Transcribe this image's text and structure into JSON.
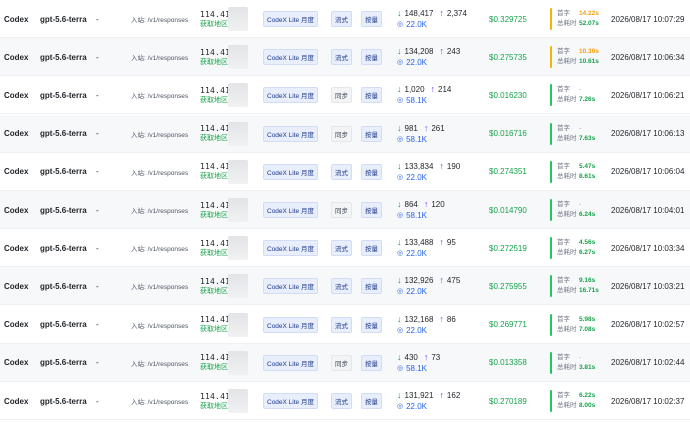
{
  "labels": {
    "first_token": "首字",
    "total_time": "总耗时",
    "endpoint_prefix": "入站: ",
    "cache_icon": "database-icon",
    "down_icon": "arrow-down-icon",
    "up_icon": "arrow-up-icon"
  },
  "colors": {
    "accent_green": "#16a34a",
    "accent_blue": "#2563eb",
    "accent_purple": "#7c3aed",
    "accent_orange": "#f59e0b",
    "plan_badge_bg": "#e8eefc"
  },
  "rows": [
    {
      "provider": "Codex",
      "model": "gpt-5.6-terra",
      "dash": "-",
      "endpoint": "入站: /v1/responses",
      "ip": "114.41",
      "geo": "获取地区",
      "plan": "CodeX Lite 月度",
      "mode": "流式",
      "mode_type": "stream",
      "billing": "按量",
      "input": "148,417",
      "output": "2,374",
      "cache": "22.0K",
      "cost": "$0.329725",
      "first_token": "14.22s",
      "first_token_color": "orange",
      "total": "52.07s",
      "total_color": "green",
      "bar": "yellow",
      "time": "2026/08/17 10:07:29"
    },
    {
      "provider": "Codex",
      "model": "gpt-5.6-terra",
      "dash": "-",
      "endpoint": "入站: /v1/responses",
      "ip": "114.41",
      "geo": "获取地区",
      "plan": "CodeX Lite 月度",
      "mode": "流式",
      "mode_type": "stream",
      "billing": "按量",
      "input": "134,208",
      "output": "243",
      "cache": "22.0K",
      "cost": "$0.275735",
      "first_token": "10.30s",
      "first_token_color": "orange",
      "total": "10.61s",
      "total_color": "green",
      "bar": "yellow",
      "time": "2026/08/17 10:06:34"
    },
    {
      "provider": "Codex",
      "model": "gpt-5.6-terra",
      "dash": "-",
      "endpoint": "入站: /v1/responses",
      "ip": "114.41",
      "geo": "获取地区",
      "plan": "CodeX Lite 月度",
      "mode": "同步",
      "mode_type": "sync",
      "billing": "按量",
      "input": "1,020",
      "output": "214",
      "cache": "58.1K",
      "cost": "$0.016230",
      "first_token": "-",
      "first_token_color": "gray",
      "total": "7.26s",
      "total_color": "green",
      "bar": "green",
      "time": "2026/08/17 10:06:21"
    },
    {
      "provider": "Codex",
      "model": "gpt-5.6-terra",
      "dash": "-",
      "endpoint": "入站: /v1/responses",
      "ip": "114.41",
      "geo": "获取地区",
      "plan": "CodeX Lite 月度",
      "mode": "同步",
      "mode_type": "sync",
      "billing": "按量",
      "input": "981",
      "output": "261",
      "cache": "58.1K",
      "cost": "$0.016716",
      "first_token": "-",
      "first_token_color": "gray",
      "total": "7.63s",
      "total_color": "green",
      "bar": "green",
      "time": "2026/08/17 10:06:13"
    },
    {
      "provider": "Codex",
      "model": "gpt-5.6-terra",
      "dash": "-",
      "endpoint": "入站: /v1/responses",
      "ip": "114.41",
      "geo": "获取地区",
      "plan": "CodeX Lite 月度",
      "mode": "流式",
      "mode_type": "stream",
      "billing": "按量",
      "input": "133,834",
      "output": "190",
      "cache": "22.0K",
      "cost": "$0.274351",
      "first_token": "5.47s",
      "first_token_color": "green",
      "total": "8.61s",
      "total_color": "green",
      "bar": "green",
      "time": "2026/08/17 10:06:04"
    },
    {
      "provider": "Codex",
      "model": "gpt-5.6-terra",
      "dash": "-",
      "endpoint": "入站: /v1/responses",
      "ip": "114.41",
      "geo": "获取地区",
      "plan": "CodeX Lite 月度",
      "mode": "同步",
      "mode_type": "sync",
      "billing": "按量",
      "input": "864",
      "output": "120",
      "cache": "58.1K",
      "cost": "$0.014790",
      "first_token": "-",
      "first_token_color": "gray",
      "total": "6.24s",
      "total_color": "green",
      "bar": "green",
      "time": "2026/08/17 10:04:01"
    },
    {
      "provider": "Codex",
      "model": "gpt-5.6-terra",
      "dash": "-",
      "endpoint": "入站: /v1/responses",
      "ip": "114.41",
      "geo": "获取地区",
      "plan": "CodeX Lite 月度",
      "mode": "流式",
      "mode_type": "stream",
      "billing": "按量",
      "input": "133,488",
      "output": "95",
      "cache": "22.0K",
      "cost": "$0.272519",
      "first_token": "4.56s",
      "first_token_color": "green",
      "total": "6.27s",
      "total_color": "green",
      "bar": "green",
      "time": "2026/08/17 10:03:34"
    },
    {
      "provider": "Codex",
      "model": "gpt-5.6-terra",
      "dash": "-",
      "endpoint": "入站: /v1/responses",
      "ip": "114.41",
      "geo": "获取地区",
      "plan": "CodeX Lite 月度",
      "mode": "流式",
      "mode_type": "stream",
      "billing": "按量",
      "input": "132,926",
      "output": "475",
      "cache": "22.0K",
      "cost": "$0.275955",
      "first_token": "9.16s",
      "first_token_color": "green",
      "total": "16.71s",
      "total_color": "green",
      "bar": "green",
      "time": "2026/08/17 10:03:21"
    },
    {
      "provider": "Codex",
      "model": "gpt-5.6-terra",
      "dash": "-",
      "endpoint": "入站: /v1/responses",
      "ip": "114.41",
      "geo": "获取地区",
      "plan": "CodeX Lite 月度",
      "mode": "流式",
      "mode_type": "stream",
      "billing": "按量",
      "input": "132,168",
      "output": "86",
      "cache": "22.0K",
      "cost": "$0.269771",
      "first_token": "5.98s",
      "first_token_color": "green",
      "total": "7.08s",
      "total_color": "green",
      "bar": "green",
      "time": "2026/08/17 10:02:57"
    },
    {
      "provider": "Codex",
      "model": "gpt-5.6-terra",
      "dash": "-",
      "endpoint": "入站: /v1/responses",
      "ip": "114.41",
      "geo": "获取地区",
      "plan": "CodeX Lite 月度",
      "mode": "同步",
      "mode_type": "sync",
      "billing": "按量",
      "input": "430",
      "output": "73",
      "cache": "58.1K",
      "cost": "$0.013358",
      "first_token": "-",
      "first_token_color": "gray",
      "total": "3.81s",
      "total_color": "green",
      "bar": "green",
      "time": "2026/08/17 10:02:44"
    },
    {
      "provider": "Codex",
      "model": "gpt-5.6-terra",
      "dash": "-",
      "endpoint": "入站: /v1/responses",
      "ip": "114.41",
      "geo": "获取地区",
      "plan": "CodeX Lite 月度",
      "mode": "流式",
      "mode_type": "stream",
      "billing": "按量",
      "input": "131,921",
      "output": "162",
      "cache": "22.0K",
      "cost": "$0.270189",
      "first_token": "6.22s",
      "first_token_color": "green",
      "total": "8.00s",
      "total_color": "green",
      "bar": "green",
      "time": "2026/08/17 10:02:37"
    }
  ]
}
